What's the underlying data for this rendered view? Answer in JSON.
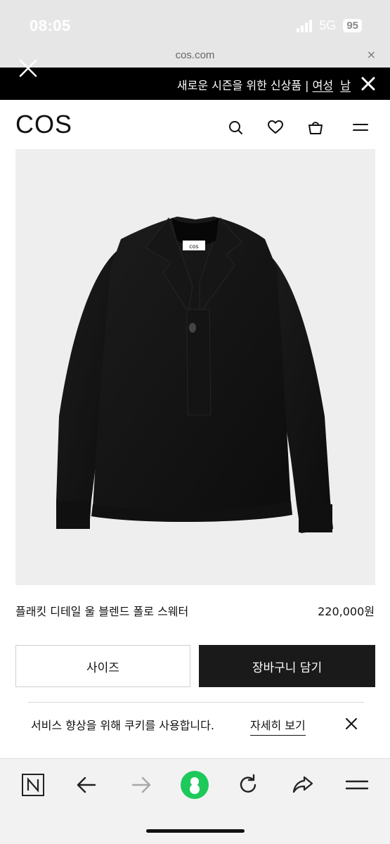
{
  "status_bar": {
    "time": "08:05",
    "network": "5G",
    "battery": "95"
  },
  "address_bar": {
    "url": "cos.com",
    "close_symbol": "×"
  },
  "banner": {
    "text": "새로운 시즌을 위한 신상품 | ",
    "link_women": "여성",
    "link_men": "남"
  },
  "header": {
    "logo": "COS"
  },
  "product_image": {
    "tag_text": "cos"
  },
  "product": {
    "name": "플래킷 디테일 울 블렌드 폴로 스웨터",
    "price": "220,000원"
  },
  "actions": {
    "size_label": "사이즈",
    "add_to_cart_label": "장바구니 담기"
  },
  "cookie": {
    "text": "서비스 향상을 위해 쿠키를 사용합니다.",
    "link": "자세히 보기"
  },
  "icons": {
    "banner_close": "close-icon",
    "search": "search-icon",
    "wishlist": "heart-icon",
    "bag": "bag-icon",
    "menu": "hamburger-menu-icon",
    "naver": "naver-n-icon",
    "back": "arrow-left-icon",
    "forward": "arrow-right-icon",
    "green_dot": "green-dot-icon",
    "reload": "reload-icon",
    "share": "share-icon",
    "more": "more-menu-icon"
  },
  "colors": {
    "banner_bg": "#000000",
    "cart_button_bg": "#1a1a1a",
    "green_dot": "#1ec95b"
  }
}
